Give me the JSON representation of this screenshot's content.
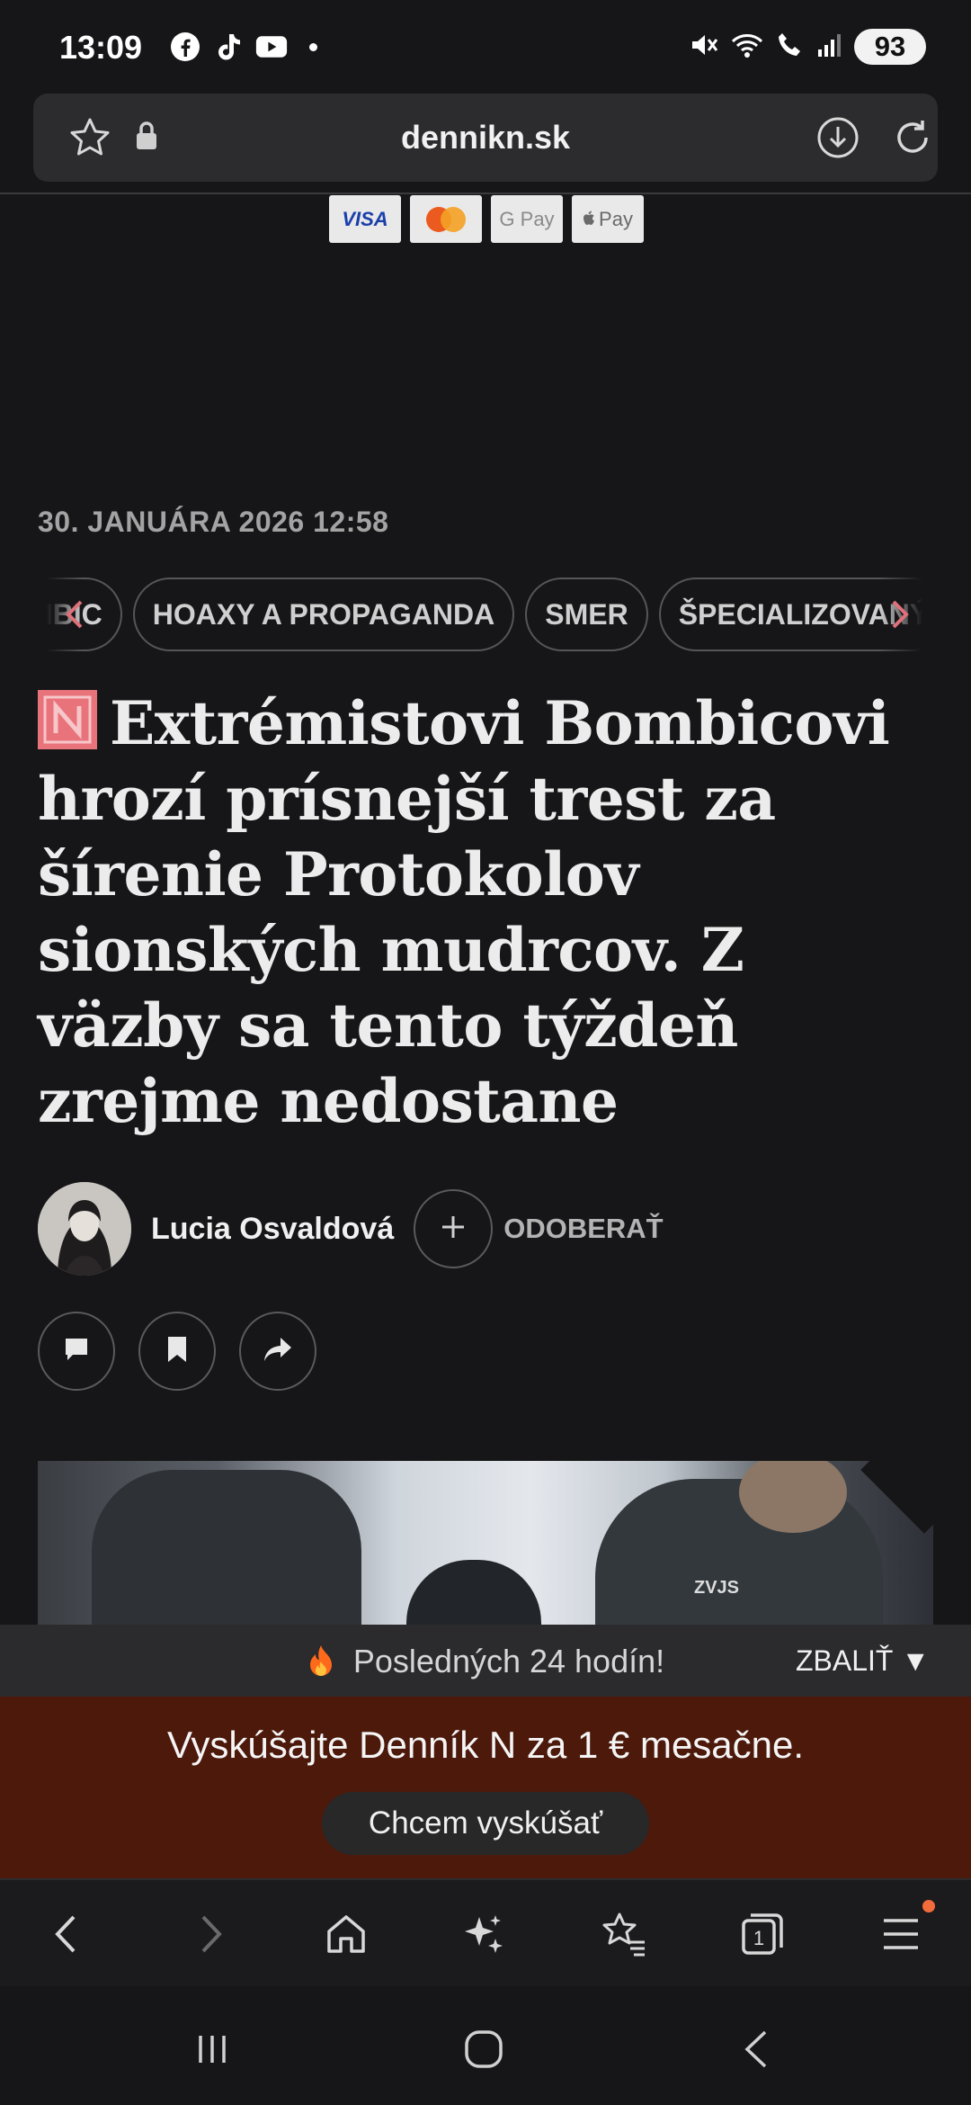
{
  "status_bar": {
    "time": "13:09",
    "apps": [
      "facebook-icon",
      "tiktok-icon",
      "youtube-icon"
    ],
    "battery": "93"
  },
  "browser": {
    "domain": "dennikn.sk"
  },
  "payments": {
    "visa": "VISA",
    "gpay": "G Pay",
    "apay": "Pay"
  },
  "article": {
    "date": "30. JANUÁRA 2026 12:58",
    "tags": [
      "BOMBIC",
      "HOAXY A PROPAGANDA",
      "SMER",
      "ŠPECIALIZOVANÝ"
    ],
    "headline": "Extrémistovi Bombicovi hrozí prísnejší trest za šírenie Protokolov sionských mudrcov. Z väzby sa tento týždeň zrejme nedostane",
    "author": "Lucia Osvaldová",
    "follow_label": "ODOBERAŤ",
    "photo_badge": "ZVJS"
  },
  "banner": {
    "last24_text": "Posledných 24 hodín!",
    "collapse_label": "ZBALIŤ ▼"
  },
  "promo": {
    "title": "Vyskúšajte Denník N za 1 € mesačne.",
    "cta": "Chcem vyskúšať"
  },
  "tab_count": "1",
  "colors": {
    "background": "#161618",
    "accent_logo": "#e8737a",
    "promo_bg": "#4c190b",
    "notification_dot": "#f26b3a"
  }
}
